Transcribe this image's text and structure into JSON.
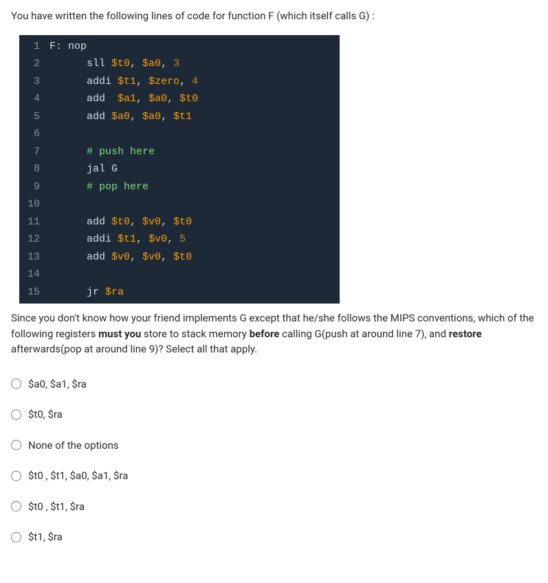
{
  "intro": "You have written the following lines of code for function F (which itself calls G) :",
  "code": {
    "lines": [
      {
        "n": "1",
        "tokens": [
          {
            "t": "F:",
            "c": "tok-label"
          },
          {
            "t": " ",
            "c": "tok-u"
          },
          {
            "t": "nop",
            "c": "tok-instr"
          }
        ]
      },
      {
        "n": "2",
        "tokens": [
          {
            "t": "      sll ",
            "c": "tok-instr"
          },
          {
            "t": "$t0",
            "c": "tok-reg-t"
          },
          {
            "t": ", ",
            "c": "tok-u"
          },
          {
            "t": "$a0",
            "c": "tok-reg-a"
          },
          {
            "t": ", ",
            "c": "tok-u"
          },
          {
            "t": "3",
            "c": "tok-num-orange"
          }
        ]
      },
      {
        "n": "3",
        "tokens": [
          {
            "t": "      addi ",
            "c": "tok-instr"
          },
          {
            "t": "$t1",
            "c": "tok-reg-t"
          },
          {
            "t": ", ",
            "c": "tok-u"
          },
          {
            "t": "$zero",
            "c": "tok-reg-zero"
          },
          {
            "t": ", ",
            "c": "tok-u"
          },
          {
            "t": "4",
            "c": "tok-num-orange"
          }
        ]
      },
      {
        "n": "4",
        "tokens": [
          {
            "t": "      add  ",
            "c": "tok-instr"
          },
          {
            "t": "$a1",
            "c": "tok-reg-a"
          },
          {
            "t": ", ",
            "c": "tok-u"
          },
          {
            "t": "$a0",
            "c": "tok-reg-a"
          },
          {
            "t": ", ",
            "c": "tok-u"
          },
          {
            "t": "$t0",
            "c": "tok-reg-t"
          }
        ]
      },
      {
        "n": "5",
        "tokens": [
          {
            "t": "      add ",
            "c": "tok-instr"
          },
          {
            "t": "$a0",
            "c": "tok-reg-a"
          },
          {
            "t": ", ",
            "c": "tok-u"
          },
          {
            "t": "$a0",
            "c": "tok-reg-a"
          },
          {
            "t": ", ",
            "c": "tok-u"
          },
          {
            "t": "$t1",
            "c": "tok-reg-t"
          }
        ]
      },
      {
        "n": "6",
        "tokens": [
          {
            "t": " ",
            "c": "tok-u"
          }
        ]
      },
      {
        "n": "7",
        "tokens": [
          {
            "t": "      # push here",
            "c": "tok-comment"
          }
        ]
      },
      {
        "n": "8",
        "tokens": [
          {
            "t": "      jal ",
            "c": "tok-instr"
          },
          {
            "t": "G",
            "c": "tok-g"
          }
        ]
      },
      {
        "n": "9",
        "tokens": [
          {
            "t": "      # pop here",
            "c": "tok-comment"
          }
        ]
      },
      {
        "n": "10",
        "tokens": [
          {
            "t": " ",
            "c": "tok-u"
          }
        ]
      },
      {
        "n": "11",
        "tokens": [
          {
            "t": "      add ",
            "c": "tok-instr"
          },
          {
            "t": "$t0",
            "c": "tok-reg-t"
          },
          {
            "t": ", ",
            "c": "tok-u"
          },
          {
            "t": "$v0",
            "c": "tok-reg-v"
          },
          {
            "t": ", ",
            "c": "tok-u"
          },
          {
            "t": "$t0",
            "c": "tok-reg-t"
          }
        ]
      },
      {
        "n": "12",
        "tokens": [
          {
            "t": "      addi ",
            "c": "tok-instr"
          },
          {
            "t": "$t1",
            "c": "tok-reg-t"
          },
          {
            "t": ", ",
            "c": "tok-u"
          },
          {
            "t": "$v0",
            "c": "tok-reg-v"
          },
          {
            "t": ", ",
            "c": "tok-u"
          },
          {
            "t": "5",
            "c": "tok-num-orange"
          }
        ]
      },
      {
        "n": "13",
        "tokens": [
          {
            "t": "      add ",
            "c": "tok-instr"
          },
          {
            "t": "$v0",
            "c": "tok-reg-v"
          },
          {
            "t": ", ",
            "c": "tok-u"
          },
          {
            "t": "$v0",
            "c": "tok-reg-v"
          },
          {
            "t": ", ",
            "c": "tok-u"
          },
          {
            "t": "$t0",
            "c": "tok-reg-t"
          }
        ]
      },
      {
        "n": "14",
        "tokens": [
          {
            "t": " ",
            "c": "tok-u"
          }
        ]
      },
      {
        "n": "15",
        "tokens": [
          {
            "t": "      jr ",
            "c": "tok-instr"
          },
          {
            "t": "$ra",
            "c": "tok-reg-ra"
          }
        ]
      }
    ],
    "overflow_n": "16"
  },
  "question_parts": {
    "p1": "Since you don't know how your friend implements G except that he/she follows the MIPS conventions, which of the following registers ",
    "b1": "must you",
    "p2": " store to stack memory ",
    "b2": "before",
    "p3": " calling G(push at around line 7), and ",
    "b3": "restore",
    "p4": " afterwards(pop at around line 9)? Select all that apply."
  },
  "options": [
    "$a0, $a1, $ra",
    "$t0, $ra",
    "None of the options",
    "$t0 , $t1, $a0, $a1, $ra",
    "$t0 , $t1, $ra",
    "$t1, $ra"
  ]
}
